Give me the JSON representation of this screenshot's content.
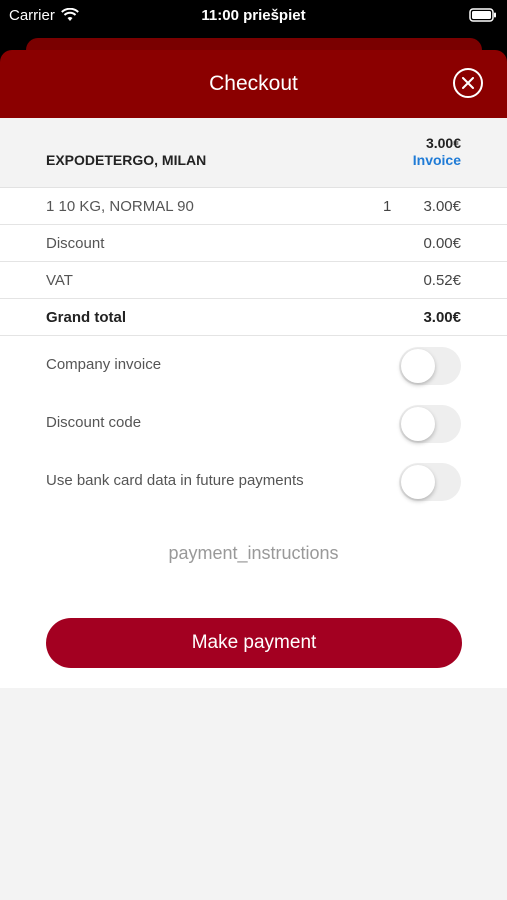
{
  "status_bar": {
    "carrier": "Carrier",
    "time": "11:00 priešpiet",
    "wifi_icon": "wifi-icon",
    "battery_icon": "battery-icon"
  },
  "header": {
    "title": "Checkout",
    "close_icon": "close-icon"
  },
  "merchant": {
    "name": "EXPODETERGO, MILAN",
    "amount": "3.00€",
    "invoice_link": "Invoice"
  },
  "items": [
    {
      "label": "1 10 KG, NORMAL 90",
      "qty": "1",
      "value": "3.00€"
    }
  ],
  "summary": {
    "discount_label": "Discount",
    "discount_value": "0.00€",
    "vat_label": "VAT",
    "vat_value": "0.52€",
    "total_label": "Grand total",
    "total_value": "3.00€"
  },
  "options": {
    "company_invoice": {
      "label": "Company invoice",
      "on": false
    },
    "discount_code": {
      "label": "Discount code",
      "on": false
    },
    "save_card": {
      "label": "Use bank card data in future payments",
      "on": false
    }
  },
  "instructions": "payment_instructions",
  "pay_button": "Make payment",
  "colors": {
    "header": "#8b0000",
    "button": "#a30021",
    "link": "#1f7bd6"
  }
}
